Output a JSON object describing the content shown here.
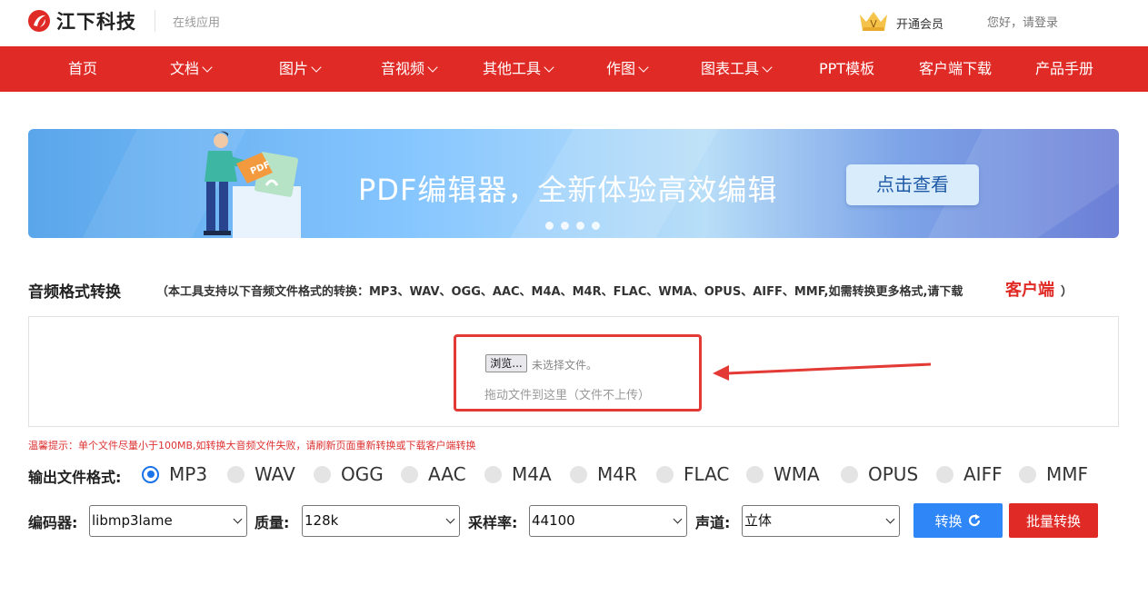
{
  "header": {
    "logo_text": "江下科技",
    "logo_sub": "在线应用",
    "vip_label": "开通会员",
    "vip_badge": "V",
    "login_text": "您好，请登录"
  },
  "nav": {
    "items": [
      {
        "label": "首页",
        "dropdown": false
      },
      {
        "label": "文档",
        "dropdown": true
      },
      {
        "label": "图片",
        "dropdown": true
      },
      {
        "label": "音视频",
        "dropdown": true
      },
      {
        "label": "其他工具",
        "dropdown": true
      },
      {
        "label": "作图",
        "dropdown": true
      },
      {
        "label": "图表工具",
        "dropdown": true
      },
      {
        "label": "PPT模板",
        "dropdown": false
      },
      {
        "label": "客户端下载",
        "dropdown": false
      },
      {
        "label": "产品手册",
        "dropdown": false
      }
    ]
  },
  "banner": {
    "headline": "PDF编辑器，全新体验高效编辑",
    "button": "点击查看",
    "badge": "PDF",
    "slide_count": 4
  },
  "section": {
    "title": "音频格式转换",
    "desc": "（本工具支持以下音频文件格式的转换：MP3、WAV、OGG、AAC、M4A、M4R、FLAC、WMA、OPUS、AIFF、MMF,如需转换更多格式,请下载",
    "client_link": "客户端",
    "desc_close": "）"
  },
  "upload": {
    "browse_label": "浏览...",
    "no_file_text": "未选择文件。",
    "drag_hint": "拖动文件到这里（文件不上传）"
  },
  "tip": "温馨提示：单个文件尽量小于100MB,如转换大音频文件失败，请刷新页面重新转换或下载客户端转换",
  "output": {
    "label": "输出文件格式:",
    "selected": "MP3",
    "formats": [
      "MP3",
      "WAV",
      "OGG",
      "AAC",
      "M4A",
      "M4R",
      "FLAC",
      "WMA",
      "OPUS",
      "AIFF",
      "MMF"
    ]
  },
  "controls": {
    "codec_label": "编码器:",
    "codec_value": "libmp3lame",
    "quality_label": "质量:",
    "quality_value": "128k",
    "samplerate_label": "采样率:",
    "samplerate_value": "44100",
    "channel_label": "声道:",
    "channel_value": "立体",
    "convert_label": "转换",
    "batch_label": "批量转换"
  },
  "colors": {
    "brand_red": "#e02a26",
    "primary_blue": "#2f86f6"
  }
}
